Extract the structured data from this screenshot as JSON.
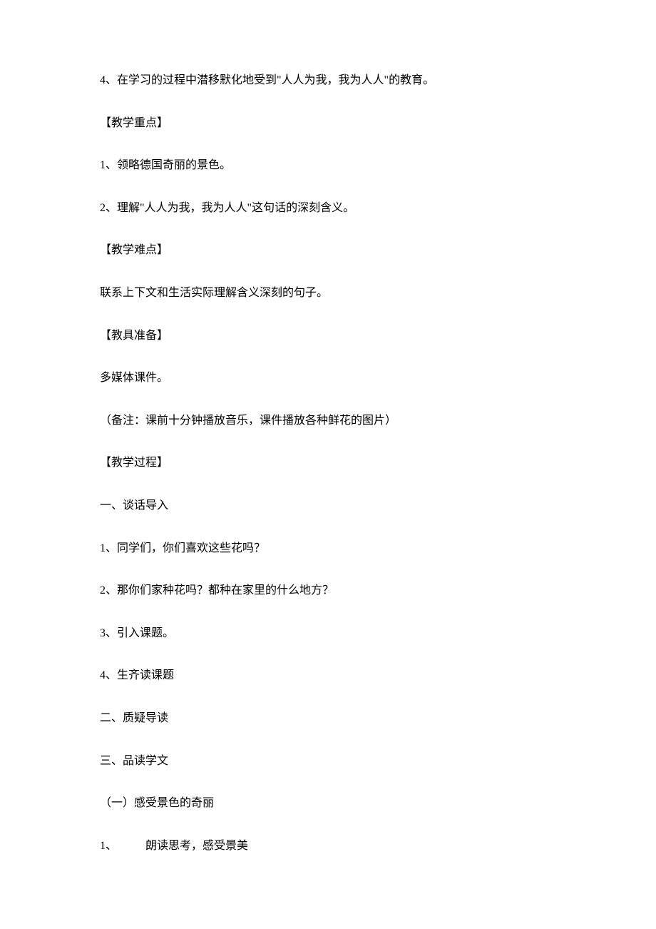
{
  "lines": [
    "4、在学习的过程中潜移默化地受到\"人人为我，我为人人\"的教育。",
    "【教学重点】",
    "1、领略德国奇丽的景色。",
    "2、理解\"人人为我，我为人人\"这句话的深刻含义。",
    "【教学难点】",
    "联系上下文和生活实际理解含义深刻的句子。",
    "【教具准备】",
    "多媒体课件。",
    "（备注：课前十分钟播放音乐，课件播放各种鲜花的图片）",
    "【教学过程】",
    "一、谈话导入",
    "1、同学们，你们喜欢这些花吗？",
    "2、那你们家种花吗？都种在家里的什么地方？",
    "3、引入课题。",
    "4、生齐读课题",
    "二、质疑导读",
    "三、品读学文",
    "（一）感受景色的奇丽",
    "1、          朗读思考，感受景美"
  ]
}
